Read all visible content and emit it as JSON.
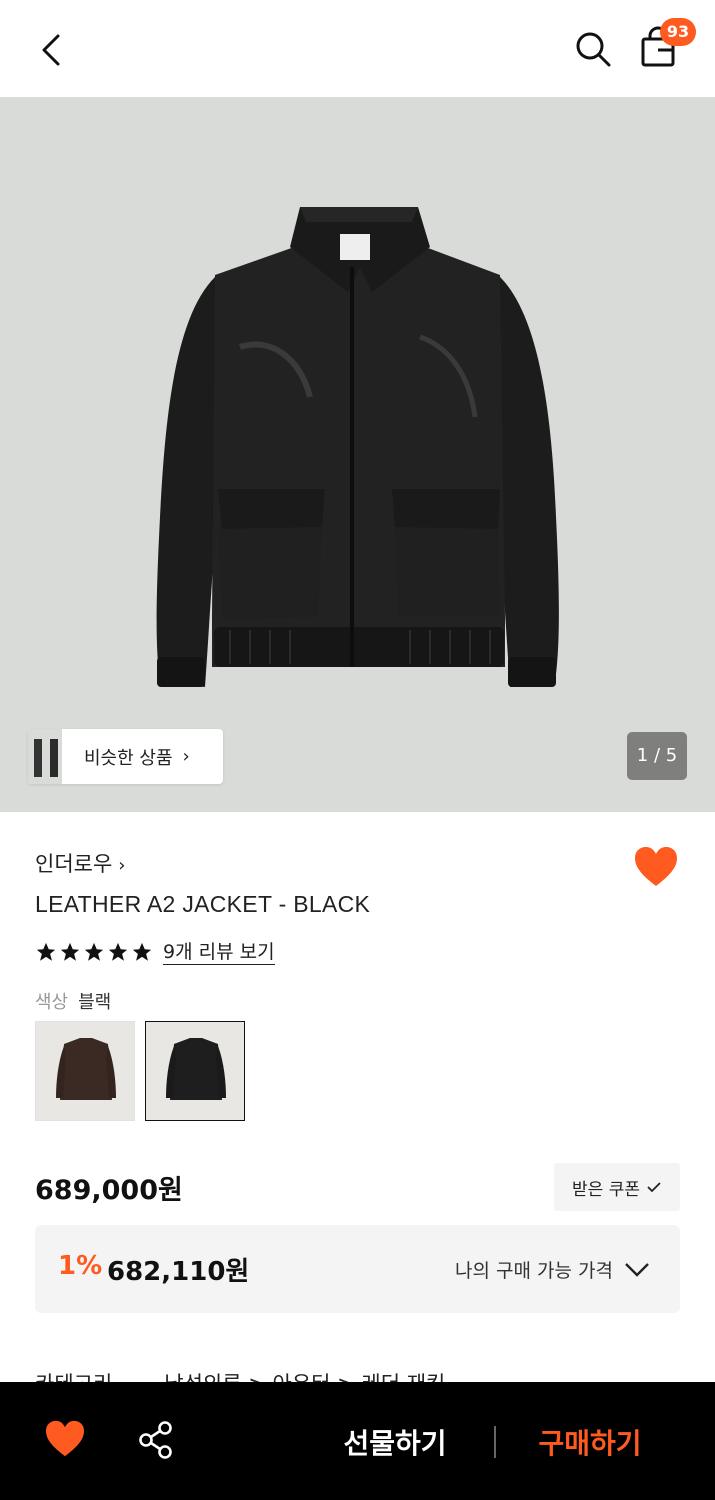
{
  "header": {
    "cart_count": "93"
  },
  "gallery": {
    "similar_label": "비슷한 상품",
    "page_indicator": "1 / 5"
  },
  "product": {
    "brand": "인더로우",
    "title": "LEATHER A2 JACKET - BLACK",
    "rating": 5,
    "review_link": "9개 리뷰 보기",
    "color_key": "색상",
    "color_value": "블랙",
    "price": "689,000원",
    "coupon_label": "받은 쿠폰",
    "discount_rate": "1%",
    "discount_price": "682,110원",
    "discount_label": "나의 구매 가능 가격",
    "category_key": "카테고리",
    "category_path": "남성의류 > 아우터 > 레더 재킷"
  },
  "bottom_bar": {
    "gift_label": "선물하기",
    "buy_label": "구매하기"
  },
  "colors": {
    "accent": "#ff5a1f",
    "bar_bg": "#000000"
  }
}
